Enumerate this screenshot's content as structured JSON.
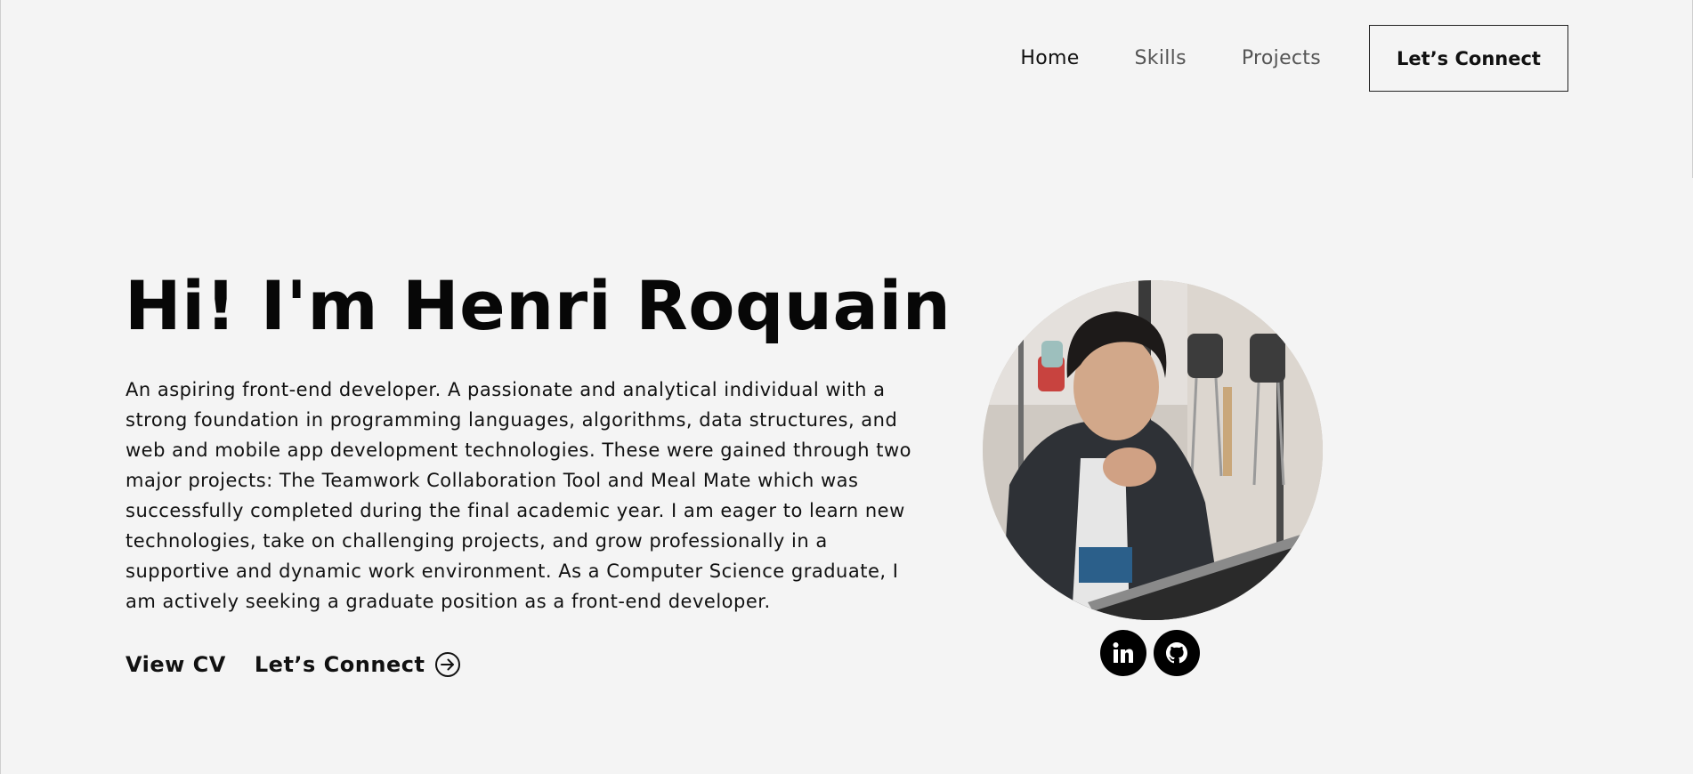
{
  "nav": {
    "items": [
      {
        "label": "Home"
      },
      {
        "label": "Skills"
      },
      {
        "label": "Projects"
      }
    ],
    "connect_button": "Let’s Connect"
  },
  "hero": {
    "title": "Hi! I'm Henri Roquain",
    "description": "An aspiring front-end developer. A passionate and analytical individual with a strong foundation in programming languages, algorithms, data structures, and web and mobile app development technologies. These were gained through two major projects: The Teamwork Collaboration Tool and Meal Mate which was successfully completed during the final academic year. I am eager to learn new technologies, take on challenging projects, and grow professionally in a supportive and dynamic work environment. As a Computer Science graduate, I am actively seeking a graduate position as a front-end developer.",
    "view_cv": "View CV",
    "connect_link": "Let’s Connect"
  },
  "socials": [
    {
      "icon": "linkedin-icon"
    },
    {
      "icon": "github-icon"
    }
  ],
  "colors": {
    "background": "#f4f4f4",
    "text": "#000000",
    "nav_inactive": "#555555"
  }
}
